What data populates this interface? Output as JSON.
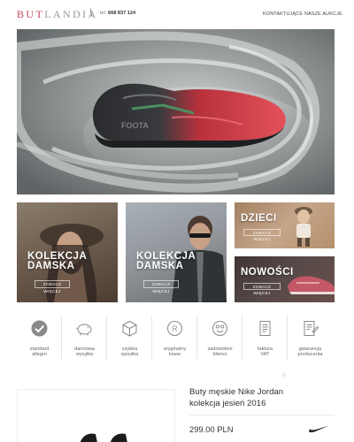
{
  "header": {
    "logo_part1": "BUT",
    "logo_part2": "LANDIA",
    "logo_slash": "\\",
    "phone_prefix": "tel.",
    "phone_number": "668 837 124",
    "nav": [
      "KONTAKTUJĄCE",
      "NASZE AUKCJE"
    ]
  },
  "hero": {
    "image": "red-football-boot-in-water-splash"
  },
  "tiles": [
    {
      "title_line1": "KOLEKCJA",
      "title_line2": "DAMSKA",
      "button": "ZOBACZ WIĘCEJ"
    },
    {
      "title_line1": "KOLEKCJA",
      "title_line2": "DAMSKA",
      "button": "ZOBACZ WIĘCEJ"
    },
    {
      "title": "DZIECI",
      "button": "ZOBACZ WIĘCEJ"
    },
    {
      "title": "NOWOŚCI",
      "button": "ZOBACZ WIĘCEJ"
    }
  ],
  "features": [
    {
      "icon": "check-circle-icon",
      "line1": "standard",
      "line2": "allegro"
    },
    {
      "icon": "piggy-bank-icon",
      "line1": "darmowa",
      "line2": "wysyłka"
    },
    {
      "icon": "box-icon",
      "line1": "szybka",
      "line2": "wysyłka"
    },
    {
      "icon": "registered-icon",
      "line1": "oryginalny",
      "line2": "towar"
    },
    {
      "icon": "smiley-icon",
      "line1": "zadowoleni",
      "line2": "klienci"
    },
    {
      "icon": "invoice-icon",
      "line1": "faktura",
      "line2": "VAT"
    },
    {
      "icon": "warranty-icon",
      "line1": "gwarancja",
      "line2": "producenta"
    }
  ],
  "product": {
    "title_line1": "Buty męskie Nike Jordan",
    "title_line2": "kolekcja jesień 2016",
    "price": "299.00 PLN",
    "brand_logo": "nike-swoosh-icon"
  },
  "colors": {
    "logo_accent": "#c8475c",
    "logo_gray": "#9a9a9a",
    "shoe_red": "#d2303b"
  }
}
